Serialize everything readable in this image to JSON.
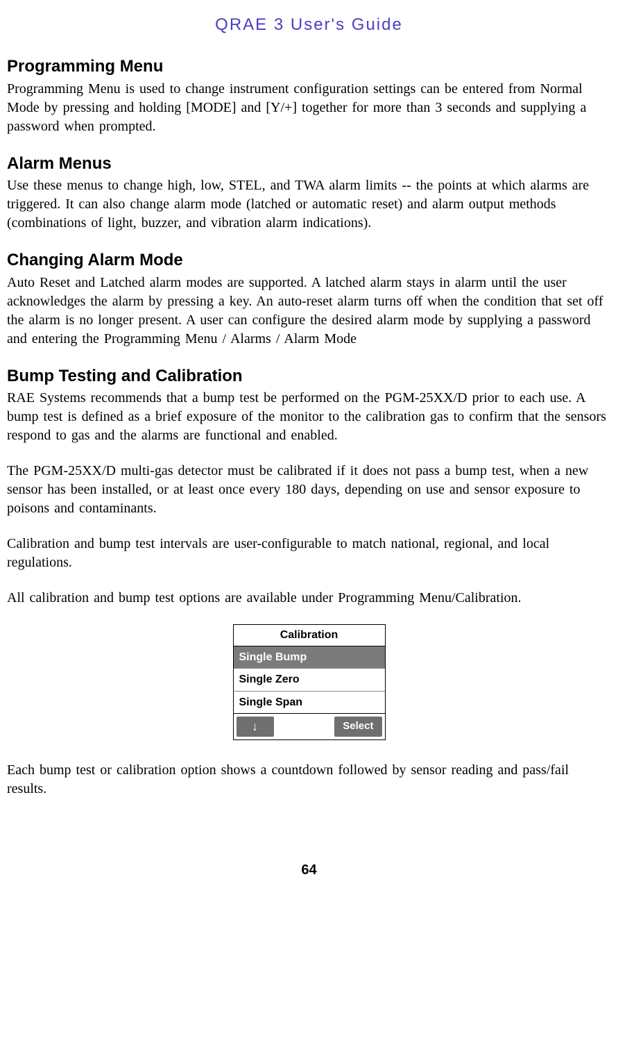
{
  "header": {
    "title": "QRAE 3 User's Guide"
  },
  "sections": {
    "programming": {
      "heading": "Programming Menu",
      "body": "Programming  Menu is used to change  instrument  configuration  settings  can be entered from  Normal  Mode by pressing  and holding  [MODE] and [Y/+] together  for more than 3 seconds and supplying  a password when prompted."
    },
    "alarm_menus": {
      "heading": "Alarm Menus",
      "body": "Use these menus  to change  high,  low, STEL, and TWA alarm  limits  -- the points at which  alarms  are triggered.  It can also change  alarm  mode (latched  or automatic  reset) and alarm  output methods  (combinations  of light,  buzzer,  and vibration  alarm indications)."
    },
    "changing_alarm_mode": {
      "heading": "Changing Alarm Mode",
      "body": "Auto Reset and Latched alarm  modes are supported. A latched  alarm stays in alarm until the user acknowledges  the alarm  by pressing  a key. An auto-reset alarm  turns  off when the condition  that set off the alarm is no longer  present. A user can configure  the desired alarm mode by supplying  a password and entering  the Programming  Menu / Alarms  / Alarm  Mode"
    },
    "bump_testing": {
      "heading": "Bump Testing and Calibration",
      "p1": "RAE Systems recommends  that a bump  test be performed  on the PGM-25XX/D prior to each use. A bump  test is defined  as a brief exposure of the monitor  to the calibration  gas to confirm  that the sensors respond to gas and the alarms  are functional  and enabled.",
      "p2": "The  PGM-25XX/D multi-gas  detector must be calibrated  if it does not pass a bump test, when a new sensor has been installed,  or at least once every 180 days, depending  on use and sensor exposure to poisons  and contaminants.",
      "p3": "Calibration  and bump  test intervals  are user-configurable  to match national,  regional,  and local regulations.",
      "p4": "All calibration  and bump test options  are available  under Programming Menu/Calibration.",
      "p5": "Each bump test or calibration  option shows a countdown  followed  by sensor reading  and pass/fail  results."
    }
  },
  "calibration_panel": {
    "title": "Calibration",
    "rows": [
      {
        "label": "Single Bump",
        "selected": true
      },
      {
        "label": "Single Zero",
        "selected": false
      },
      {
        "label": "Single Span",
        "selected": false
      }
    ],
    "footer": {
      "left_icon": "↓",
      "right_label": "Select"
    }
  },
  "page_number": "64"
}
